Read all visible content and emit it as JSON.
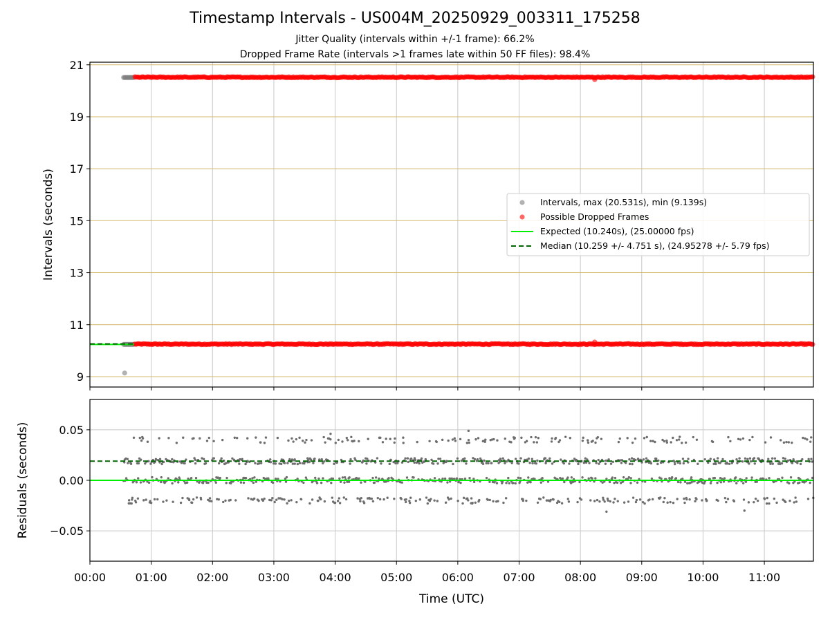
{
  "title": "Timestamp Intervals - US004M_20250929_003311_175258",
  "subtitle_1": "Jitter Quality (intervals within +/-1 frame): 66.2%",
  "subtitle_2": "Dropped Frame Rate (intervals >1 frames late within 50 FF files): 98.4%",
  "colors": {
    "gridline_top": "#d4b96a",
    "gridline_bottom": "#c8c8c8",
    "gridline_vertical": "#c8c8c8",
    "intervals_points": "#7f7f7f",
    "dropped_points": "#ff0000",
    "expected_line": "#00ee00",
    "median_line": "#006400",
    "residual_points": "#6e6e6e"
  },
  "chart_data": [
    {
      "type": "scatter",
      "panel": "top",
      "ylabel": "Intervals (seconds)",
      "ylim": [
        8.6,
        21.1
      ],
      "xlim": [
        "00:00",
        "11:48"
      ],
      "grid": true,
      "yticks": [
        "9",
        "11",
        "13",
        "15",
        "17",
        "19",
        "21"
      ],
      "legend_position": "center-right",
      "series": [
        {
          "name": "Intervals, max (20.531s), min (9.139s)",
          "marker": "circle",
          "color": "gray",
          "x_start": "00:33",
          "x_end": "00:43",
          "levels": [
            10.24,
            20.51
          ],
          "outliers": [
            {
              "x": "00:34",
              "y": 9.139
            }
          ]
        },
        {
          "name": "Possible Dropped Frames",
          "marker": "circle",
          "color": "red",
          "x_start": "00:44",
          "x_end": "11:48",
          "levels": [
            10.25,
            20.52
          ],
          "outliers": [
            {
              "x": "08:14",
              "y": 20.43
            },
            {
              "x": "08:14",
              "y": 10.33
            }
          ]
        },
        {
          "name": "Expected (10.240s), (25.00000 fps)",
          "line_style": "solid",
          "color": "lime",
          "y": 10.24
        },
        {
          "name": "Median (10.259 +/- 4.751 s), (24.95278 +/- 5.79 fps)",
          "line_style": "dashed",
          "color": "darkgreen",
          "y": 10.259
        }
      ]
    },
    {
      "type": "scatter",
      "panel": "bottom",
      "xlabel": "Time (UTC)",
      "ylabel": "Residuals (seconds)",
      "ylim": [
        -0.08,
        0.08
      ],
      "yticks": [
        "0.05",
        "0.00",
        "−0.05"
      ],
      "xticks": [
        "00:00",
        "01:00",
        "02:00",
        "03:00",
        "04:00",
        "05:00",
        "06:00",
        "07:00",
        "08:00",
        "09:00",
        "10:00",
        "11:00"
      ],
      "xlim": [
        "00:00",
        "11:48"
      ],
      "grid": true,
      "residual_levels": [
        -0.02,
        0.0,
        0.019,
        0.04
      ],
      "residual_outliers": [
        0.046,
        0.049,
        -0.031,
        -0.03
      ],
      "x_start": "00:33",
      "x_end": "11:48",
      "lines": [
        {
          "name": "expected",
          "y": 0.0,
          "style": "solid",
          "color": "lime"
        },
        {
          "name": "median",
          "y": 0.019,
          "style": "dashed",
          "color": "darkgreen"
        }
      ]
    }
  ]
}
